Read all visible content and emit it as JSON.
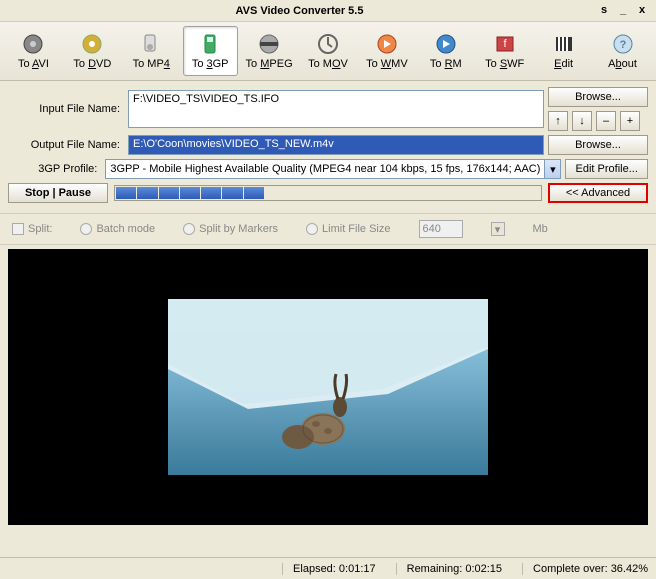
{
  "window": {
    "title": "AVS Video Converter 5.5",
    "min": "s",
    "hide": "_",
    "close": "x"
  },
  "toolbar": [
    {
      "label": "To AVI",
      "u": "A"
    },
    {
      "label": "To DVD",
      "u": "D"
    },
    {
      "label": "To MP4",
      "u": "4"
    },
    {
      "label": "To 3GP",
      "u": "3",
      "active": true
    },
    {
      "label": "To MPEG",
      "u": "M"
    },
    {
      "label": "To MOV",
      "u": "O"
    },
    {
      "label": "To WMV",
      "u": "W"
    },
    {
      "label": "To RM",
      "u": "R"
    },
    {
      "label": "To SWF",
      "u": "S"
    },
    {
      "label": "Edit",
      "u": "E"
    },
    {
      "label": "About",
      "u": "b"
    }
  ],
  "labels": {
    "input": "Input File Name:",
    "output": "Output File Name:",
    "profile": "3GP Profile:"
  },
  "values": {
    "input": "F:\\VIDEO_TS\\VIDEO_TS.IFO",
    "output": "E:\\O'Coon\\movies\\VIDEO_TS_NEW.m4v",
    "profile": "3GPP - Mobile Highest Available Quality (MPEG4  near 104 kbps, 15 fps, 176x144; AAC)"
  },
  "buttons": {
    "browse": "Browse...",
    "editprofile": "Edit Profile...",
    "advanced": "<< Advanced",
    "stop": "Stop  |  Pause",
    "up": "↑",
    "down": "↓",
    "minus": "–",
    "plus": "+"
  },
  "options": {
    "split": "Split:",
    "batch": "Batch mode",
    "markers": "Split by Markers",
    "limit": "Limit File Size",
    "size": "640",
    "unit": "Mb"
  },
  "status": {
    "elapsed_l": "Elapsed:",
    "elapsed_v": "0:01:17",
    "remain_l": "Remaining:",
    "remain_v": "0:02:15",
    "complete_l": "Complete over:",
    "complete_v": "36.42%"
  },
  "progress_fill": 7,
  "progress_total": 20
}
